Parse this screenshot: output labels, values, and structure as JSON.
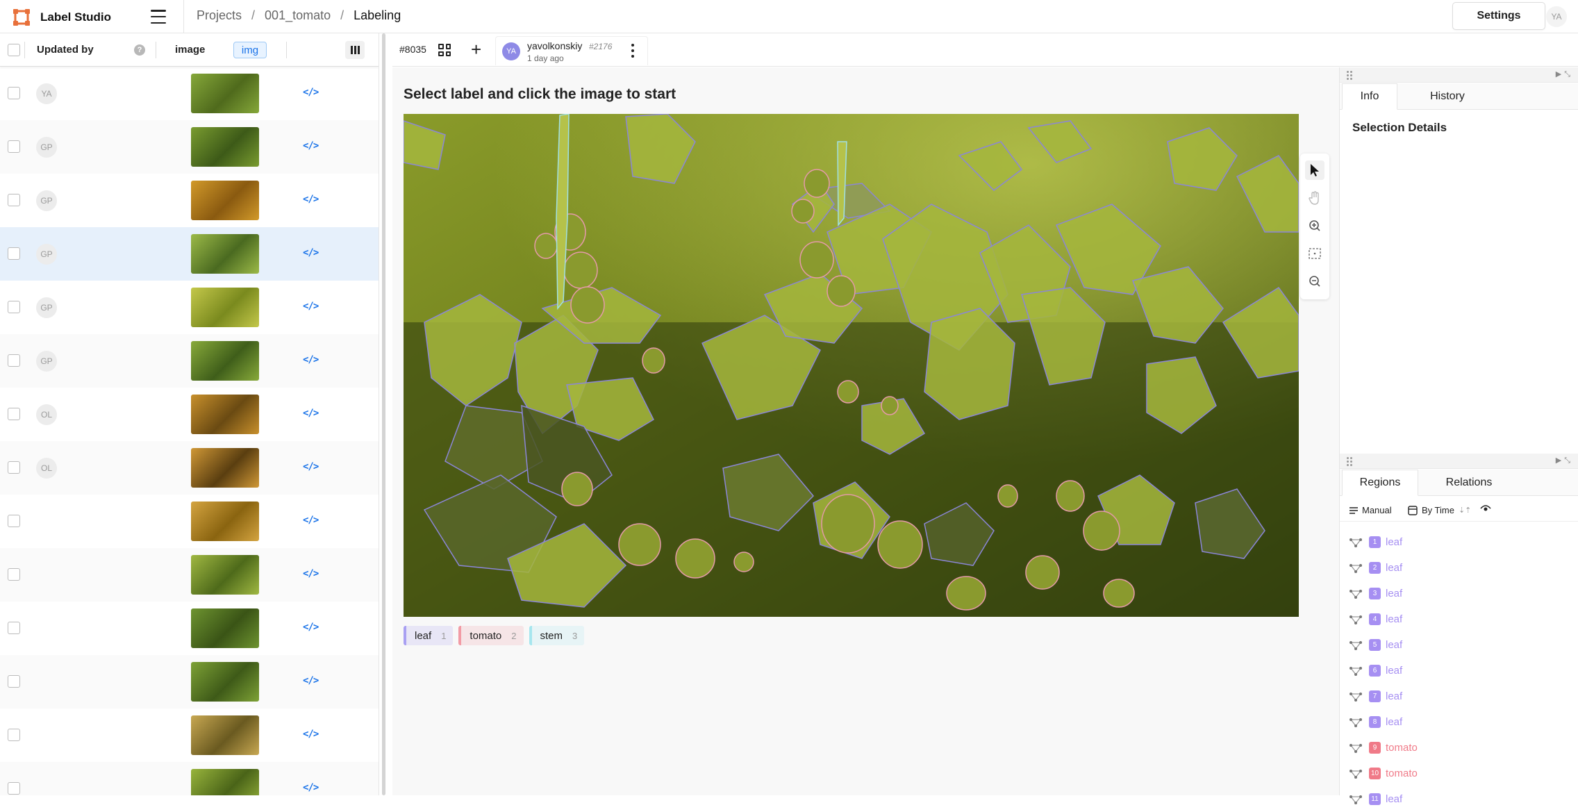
{
  "app": {
    "name": "Label Studio",
    "user_initials": "YA"
  },
  "breadcrumb": {
    "projects": "Projects",
    "sep": "/",
    "project": "001_tomato",
    "page": "Labeling"
  },
  "settings_label": "Settings",
  "table": {
    "headers": {
      "updated_by": "Updated by",
      "help": "?",
      "image": "image",
      "img_tag": "img"
    },
    "rows": [
      {
        "avatar": "YA",
        "code": "</>"
      },
      {
        "avatar": "GP",
        "code": "</>"
      },
      {
        "avatar": "GP",
        "code": "</>"
      },
      {
        "avatar": "GP",
        "code": "</>"
      },
      {
        "avatar": "GP",
        "code": "</>"
      },
      {
        "avatar": "GP",
        "code": "</>"
      },
      {
        "avatar": "OL",
        "code": "</>"
      },
      {
        "avatar": "OL",
        "code": "</>"
      },
      {
        "avatar": "",
        "code": "</>"
      },
      {
        "avatar": "",
        "code": "</>"
      },
      {
        "avatar": "",
        "code": "</>"
      },
      {
        "avatar": "",
        "code": "</>"
      },
      {
        "avatar": "",
        "code": "</>"
      },
      {
        "avatar": "",
        "code": "</>"
      }
    ]
  },
  "annotation": {
    "task_id": "#8035",
    "user_initials": "YA",
    "username": "yavolkonskiy",
    "annotation_id": "#2176",
    "time": "1 day ago"
  },
  "main": {
    "instruction": "Select label and click the image to start",
    "labels": [
      {
        "name": "leaf",
        "hotkey": "1",
        "color": "#a9a0f2"
      },
      {
        "name": "tomato",
        "hotkey": "2",
        "color": "#f29ba5"
      },
      {
        "name": "stem",
        "hotkey": "3",
        "color": "#a6e6ee"
      }
    ]
  },
  "sidebar": {
    "tabs": {
      "info": "Info",
      "history": "History"
    },
    "selection_details": "Selection Details",
    "region_tabs": {
      "regions": "Regions",
      "relations": "Relations"
    },
    "region_tools": {
      "manual": "Manual",
      "by_time": "By Time"
    },
    "regions": [
      {
        "n": "1",
        "label": "leaf",
        "color": "#a68ff2"
      },
      {
        "n": "2",
        "label": "leaf",
        "color": "#a68ff2"
      },
      {
        "n": "3",
        "label": "leaf",
        "color": "#a68ff2"
      },
      {
        "n": "4",
        "label": "leaf",
        "color": "#a68ff2"
      },
      {
        "n": "5",
        "label": "leaf",
        "color": "#a68ff2"
      },
      {
        "n": "6",
        "label": "leaf",
        "color": "#a68ff2"
      },
      {
        "n": "7",
        "label": "leaf",
        "color": "#a68ff2"
      },
      {
        "n": "8",
        "label": "leaf",
        "color": "#a68ff2"
      },
      {
        "n": "9",
        "label": "tomato",
        "color": "#f07a88"
      },
      {
        "n": "10",
        "label": "tomato",
        "color": "#f07a88"
      },
      {
        "n": "11",
        "label": "leaf",
        "color": "#a68ff2"
      }
    ]
  }
}
